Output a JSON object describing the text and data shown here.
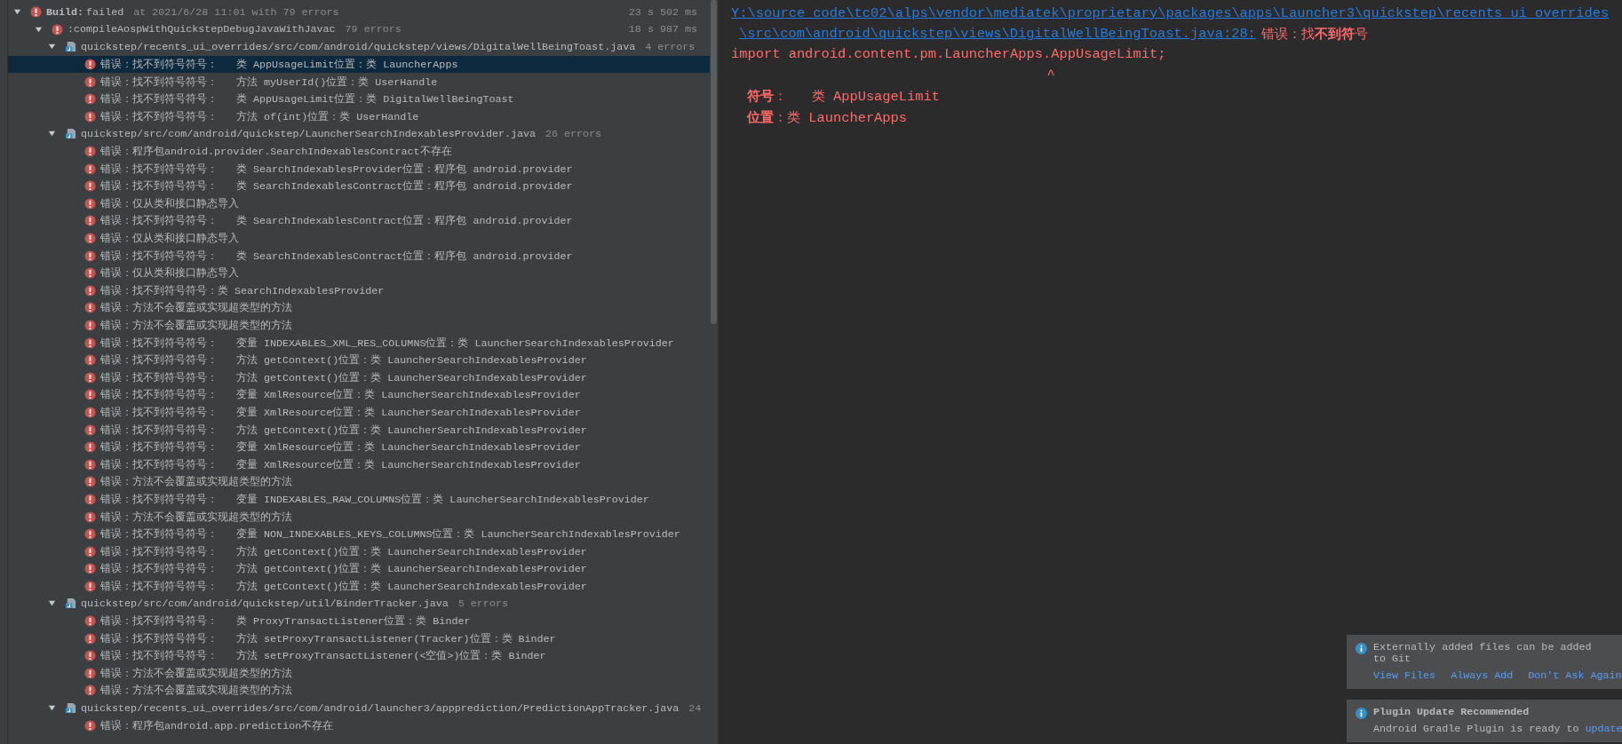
{
  "build": {
    "label": "Build:",
    "status": "failed",
    "detail": "at 2021/6/28 11:01 with 79 errors",
    "time": "23 s 502 ms",
    "expanded": true,
    "children": [
      {
        "label": ":compileAospWithQuickstepDebugJavaWithJavac",
        "count": "79 errors",
        "time": "18 s 987 ms",
        "expanded": true,
        "children": [
          {
            "path": "quickstep/recents_ui_overrides/src/com/android/quickstep/views/DigitalWellBeingToast.java",
            "count": "4 errors",
            "expanded": true,
            "children": [
              {
                "text": "错误：找不到符号符号：   类 AppUsageLimit位置：类 LauncherApps",
                "selected": true
              },
              {
                "text": "错误：找不到符号符号：   方法 myUserId()位置：类 UserHandle",
                "selected": false
              },
              {
                "text": "错误：找不到符号符号：   类 AppUsageLimit位置：类 DigitalWellBeingToast",
                "selected": false
              },
              {
                "text": "错误：找不到符号符号：   方法 of(int)位置：类 UserHandle",
                "selected": false
              }
            ]
          },
          {
            "path": "quickstep/src/com/android/quickstep/LauncherSearchIndexablesProvider.java",
            "count": "26 errors",
            "expanded": true,
            "children": [
              {
                "text": "错误：程序包android.provider.SearchIndexablesContract不存在",
                "selected": false
              },
              {
                "text": "错误：找不到符号符号：   类 SearchIndexablesProvider位置：程序包 android.provider",
                "selected": false
              },
              {
                "text": "错误：找不到符号符号：   类 SearchIndexablesContract位置：程序包 android.provider",
                "selected": false
              },
              {
                "text": "错误：仅从类和接口静态导入",
                "selected": false
              },
              {
                "text": "错误：找不到符号符号：   类 SearchIndexablesContract位置：程序包 android.provider",
                "selected": false
              },
              {
                "text": "错误：仅从类和接口静态导入",
                "selected": false
              },
              {
                "text": "错误：找不到符号符号：   类 SearchIndexablesContract位置：程序包 android.provider",
                "selected": false
              },
              {
                "text": "错误：仅从类和接口静态导入",
                "selected": false
              },
              {
                "text": "错误：找不到符号符号：类 SearchIndexablesProvider",
                "selected": false
              },
              {
                "text": "错误：方法不会覆盖或实现超类型的方法",
                "selected": false
              },
              {
                "text": "错误：方法不会覆盖或实现超类型的方法",
                "selected": false
              },
              {
                "text": "错误：找不到符号符号：   变量 INDEXABLES_XML_RES_COLUMNS位置：类 LauncherSearchIndexablesProvider",
                "selected": false
              },
              {
                "text": "错误：找不到符号符号：   方法 getContext()位置：类 LauncherSearchIndexablesProvider",
                "selected": false
              },
              {
                "text": "错误：找不到符号符号：   方法 getContext()位置：类 LauncherSearchIndexablesProvider",
                "selected": false
              },
              {
                "text": "错误：找不到符号符号：   变量 XmlResource位置：类 LauncherSearchIndexablesProvider",
                "selected": false
              },
              {
                "text": "错误：找不到符号符号：   变量 XmlResource位置：类 LauncherSearchIndexablesProvider",
                "selected": false
              },
              {
                "text": "错误：找不到符号符号：   方法 getContext()位置：类 LauncherSearchIndexablesProvider",
                "selected": false
              },
              {
                "text": "错误：找不到符号符号：   变量 XmlResource位置：类 LauncherSearchIndexablesProvider",
                "selected": false
              },
              {
                "text": "错误：找不到符号符号：   变量 XmlResource位置：类 LauncherSearchIndexablesProvider",
                "selected": false
              },
              {
                "text": "错误：方法不会覆盖或实现超类型的方法",
                "selected": false
              },
              {
                "text": "错误：找不到符号符号：   变量 INDEXABLES_RAW_COLUMNS位置：类 LauncherSearchIndexablesProvider",
                "selected": false
              },
              {
                "text": "错误：方法不会覆盖或实现超类型的方法",
                "selected": false
              },
              {
                "text": "错误：找不到符号符号：   变量 NON_INDEXABLES_KEYS_COLUMNS位置：类 LauncherSearchIndexablesProvider",
                "selected": false
              },
              {
                "text": "错误：找不到符号符号：   方法 getContext()位置：类 LauncherSearchIndexablesProvider",
                "selected": false
              },
              {
                "text": "错误：找不到符号符号：   方法 getContext()位置：类 LauncherSearchIndexablesProvider",
                "selected": false
              },
              {
                "text": "错误：找不到符号符号：   方法 getContext()位置：类 LauncherSearchIndexablesProvider",
                "selected": false
              }
            ]
          },
          {
            "path": "quickstep/src/com/android/quickstep/util/BinderTracker.java",
            "count": "5 errors",
            "expanded": true,
            "children": [
              {
                "text": "错误：找不到符号符号：   类 ProxyTransactListener位置：类 Binder",
                "selected": false
              },
              {
                "text": "错误：找不到符号符号：   方法 setProxyTransactListener(Tracker)位置：类 Binder",
                "selected": false
              },
              {
                "text": "错误：找不到符号符号：   方法 setProxyTransactListener(<空值>)位置：类 Binder",
                "selected": false
              },
              {
                "text": "错误：方法不会覆盖或实现超类型的方法",
                "selected": false
              },
              {
                "text": "错误：方法不会覆盖或实现超类型的方法",
                "selected": false
              }
            ]
          },
          {
            "path": "quickstep/recents_ui_overrides/src/com/android/launcher3/appprediction/PredictionAppTracker.java",
            "count": "24",
            "expanded": true,
            "children": [
              {
                "text": "错误：程序包android.app.prediction不存在",
                "selected": false
              }
            ]
          }
        ]
      }
    ]
  },
  "console": [
    {
      "kind": "link",
      "text": "Y:\\source_code\\tc02\\alps\\vendor\\mediatek\\proprietary\\packages\\apps\\Launcher3\\quickstep\\recents_ui_overrides"
    },
    {
      "kind": "link_message",
      "link": "\\src\\com\\android\\quickstep\\views\\DigitalWellBeingToast.java:28:",
      "message": "错误：找**不到符**号"
    },
    {
      "kind": "code",
      "text": "import android.content.pm.LauncherApps.AppUsageLimit;"
    },
    {
      "kind": "caret",
      "text": "^"
    },
    {
      "kind": "detail",
      "text": "**符号**：   类 AppUsageLimit"
    },
    {
      "kind": "detail",
      "text": "**位置**：类 LauncherApps"
    }
  ],
  "notifications": [
    {
      "title": "Externally added files can be added to Git",
      "title_bold": false,
      "actions": [
        "View Files",
        "Always Add",
        "Don't Ask Again"
      ]
    },
    {
      "title": "Plugin Update Recommended",
      "title_bold": true,
      "body": "Android Gradle Plugin is ready to ",
      "body_link": "update"
    }
  ]
}
